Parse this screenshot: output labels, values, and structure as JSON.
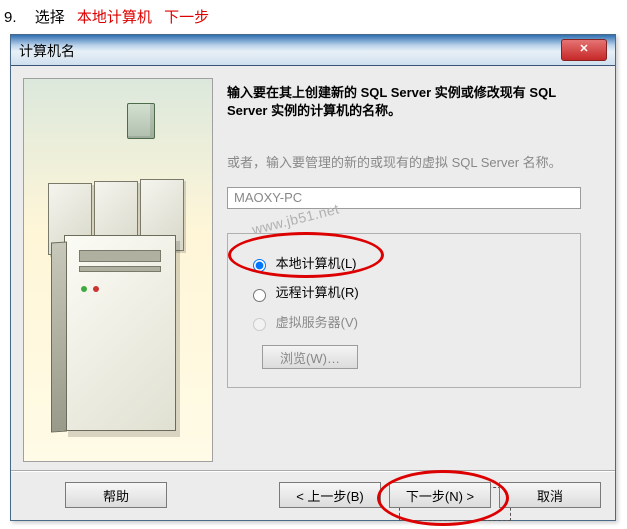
{
  "instruction": {
    "number": "9.",
    "select_label": "选择",
    "red1": "本地计算机",
    "red2": "下一步"
  },
  "dialog": {
    "title": "计算机名",
    "intro": "输入要在其上创建新的 SQL Server 实例或修改现有 SQL Server 实例的计算机的名称。",
    "subtext": "或者，输入要管理的新的或现有的虚拟 SQL Server 名称。",
    "input_value": "MAOXY-PC",
    "watermark": "www.jb51.net",
    "options": {
      "local": "本地计算机(L)",
      "remote": "远程计算机(R)",
      "virtual": "虚拟服务器(V)",
      "browse": "浏览(W)…"
    },
    "buttons": {
      "help": "帮助",
      "back": "< 上一步(B)",
      "next": "下一步(N) >",
      "cancel": "取消"
    },
    "close_glyph": "✕"
  }
}
